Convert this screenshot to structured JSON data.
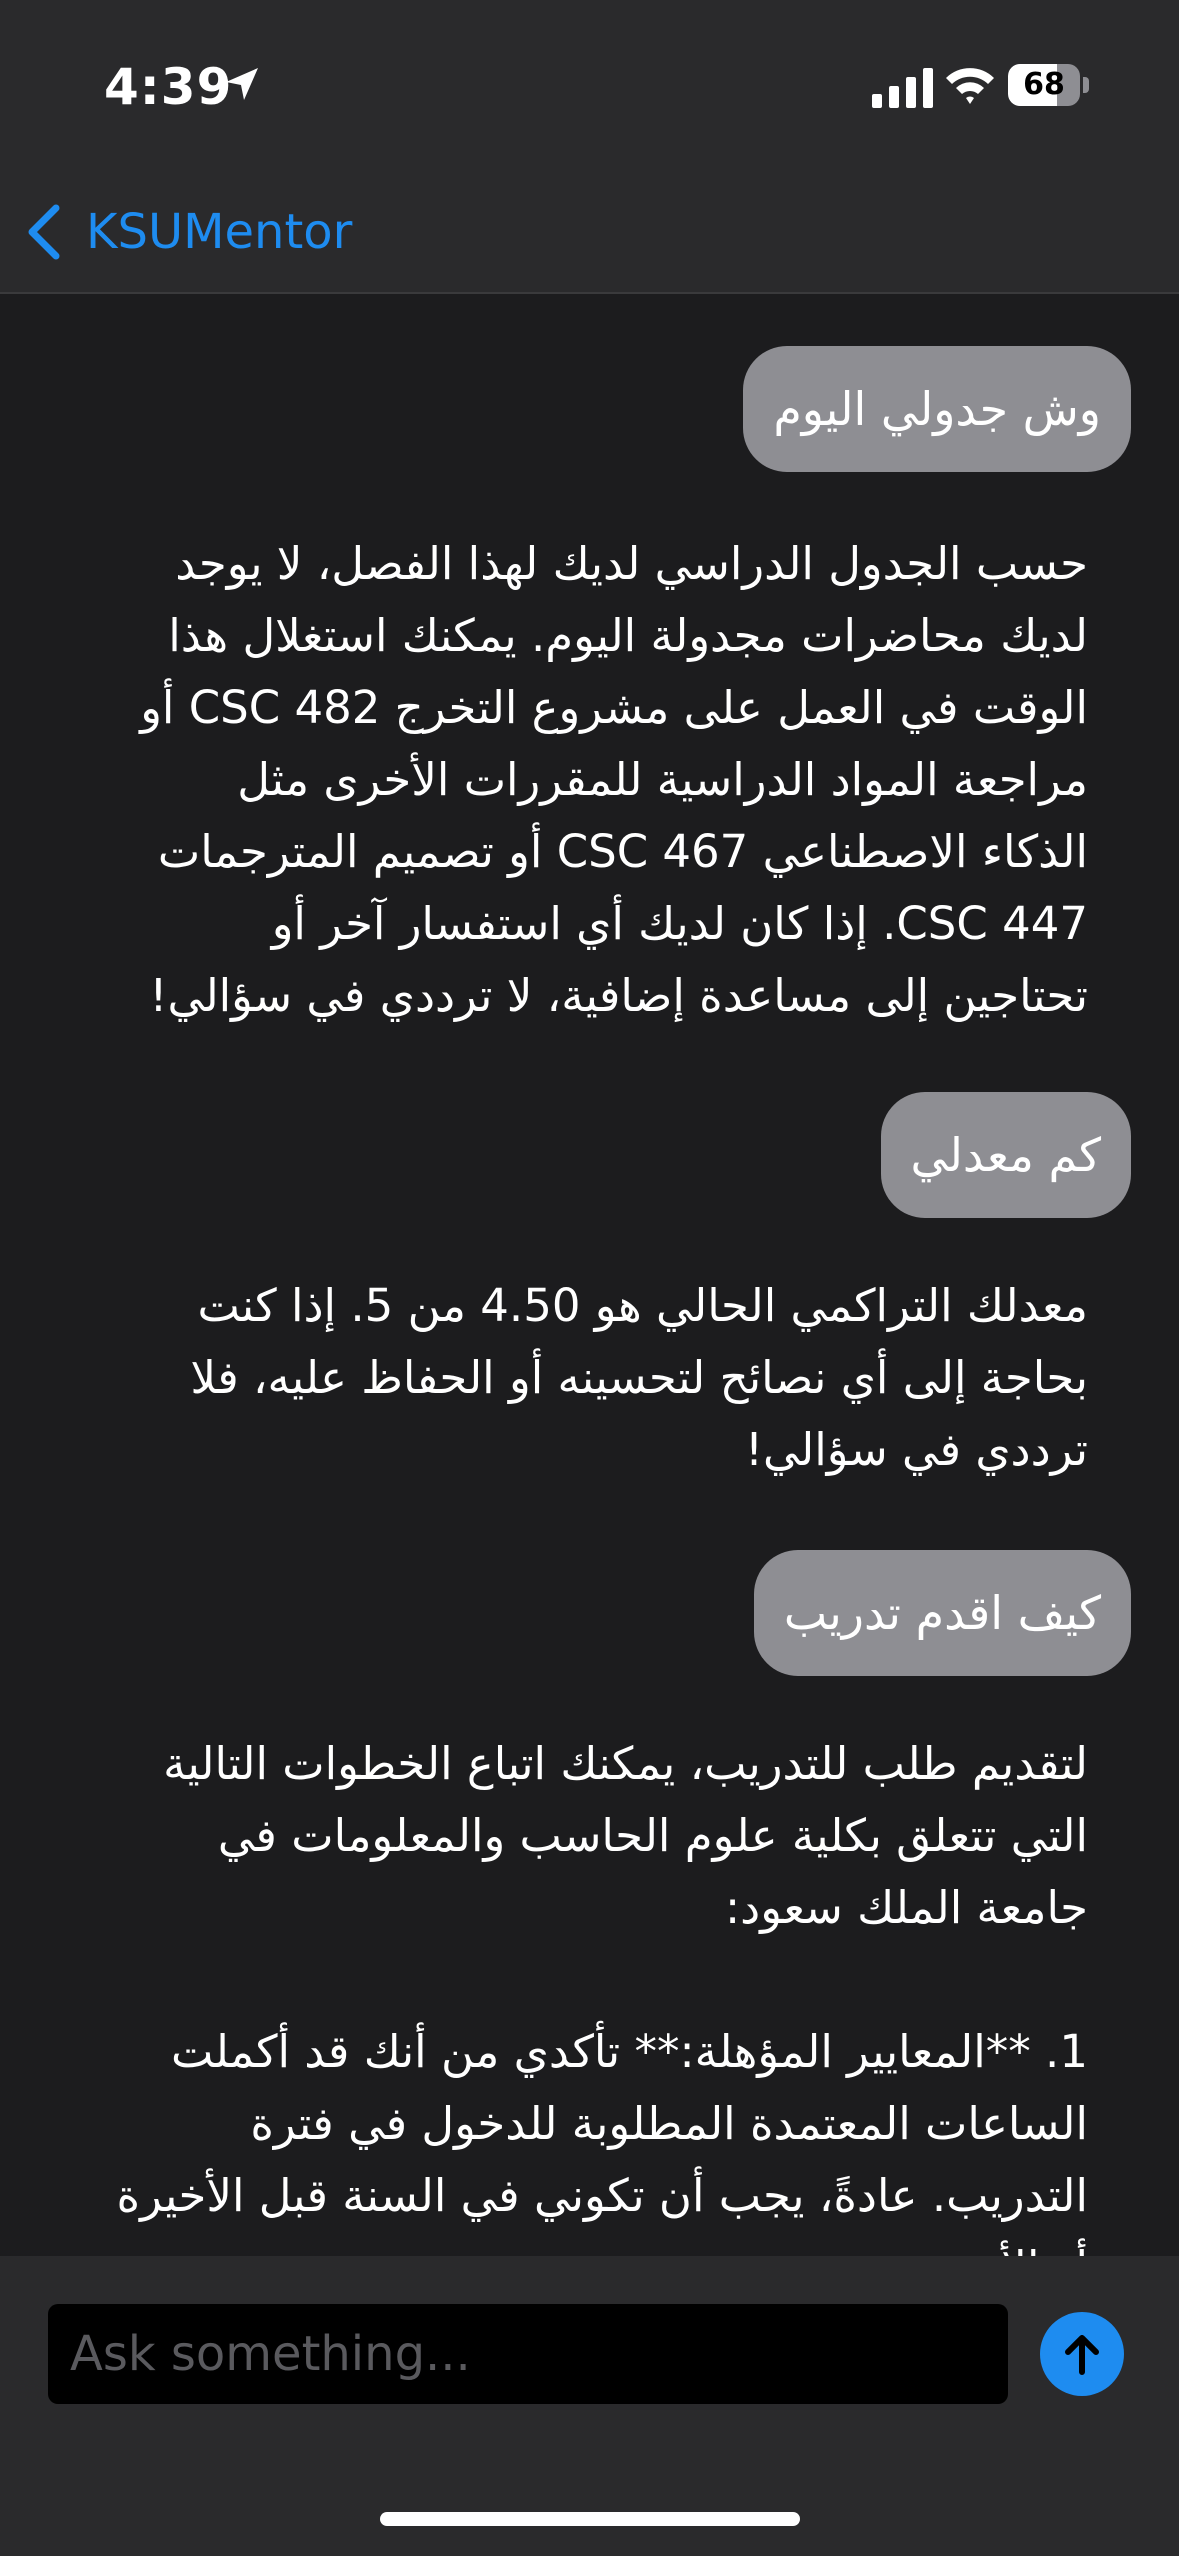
{
  "status_bar": {
    "time": "4:39",
    "battery_level": "68",
    "battery_fraction": 0.68
  },
  "nav": {
    "back_label": "KSUMentor"
  },
  "messages": [
    {
      "role": "user",
      "text": "وش جدولي اليوم"
    },
    {
      "role": "assistant",
      "lines": [
        "حسب الجدول الدراسي لديك لهذا الفصل، لا يوجد",
        "لديك محاضرات مجدولة اليوم. يمكنك استغلال هذا",
        "الوقت في العمل على مشروع التخرج CSC 482 أو",
        "مراجعة المواد الدراسية للمقررات الأخرى مثل",
        "الذكاء الاصطناعي CSC 467 أو تصميم المترجمات",
        "CSC 447. إذا كان لديك أي استفسار آخر أو",
        "تحتاجين إلى مساعدة إضافية، لا ترددي في سؤالي!"
      ]
    },
    {
      "role": "user",
      "text": "كم معدلي"
    },
    {
      "role": "assistant",
      "lines": [
        "معدلك التراكمي الحالي هو 4.50 من 5. إذا كنت",
        "بحاجة إلى أي نصائح لتحسينه أو الحفاظ عليه، فلا",
        "ترددي في سؤالي!"
      ]
    },
    {
      "role": "user",
      "text": "كيف اقدم تدريب"
    },
    {
      "role": "assistant",
      "lines": [
        "لتقديم طلب للتدريب، يمكنك اتباع الخطوات التالية",
        "التي تتعلق بكلية علوم الحاسب والمعلومات في",
        "جامعة الملك سعود:",
        "",
        "1. **المعايير المؤهلة:** تأكدي من أنك قد أكملت",
        "الساعات المعتمدة المطلوبة للدخول في فترة",
        "التدريب. عادةً، يجب أن تكوني في السنة قبل الأخيرة",
        "أو الأخيرة"
      ]
    }
  ],
  "input": {
    "placeholder": "Ask something..."
  },
  "colors": {
    "accent": "#1e8cf0",
    "user_bubble": "#8e8e93",
    "background": "#1c1c1e",
    "bar_background": "#2a2a2c"
  }
}
